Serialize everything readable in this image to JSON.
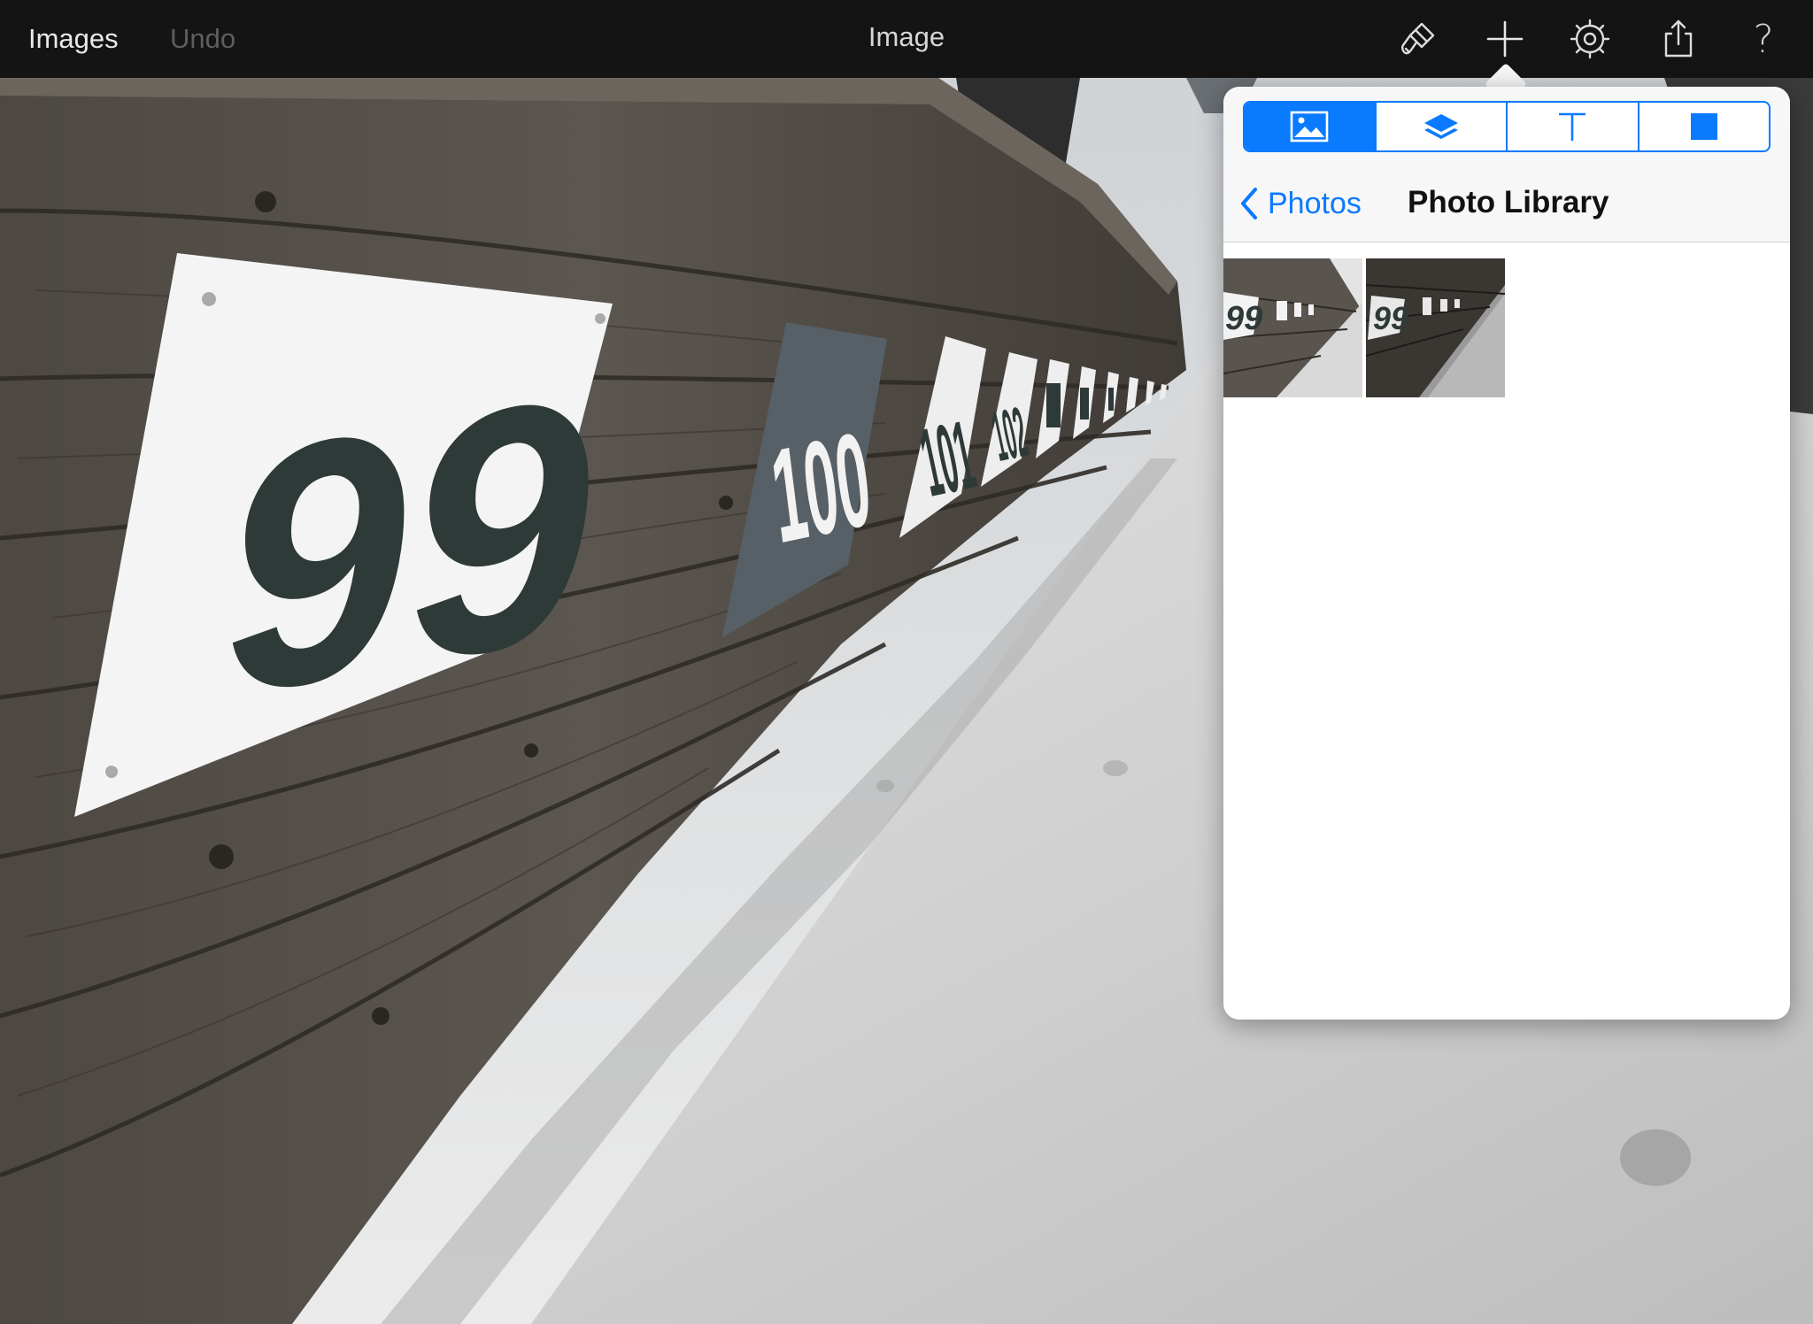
{
  "toolbar": {
    "images_label": "Images",
    "undo_label": "Undo",
    "title": "Image",
    "icons": [
      "brush-icon",
      "plus-icon",
      "gear-icon",
      "share-icon",
      "help-icon"
    ],
    "help_glyph": "?"
  },
  "photo": {
    "sign_big": "99",
    "sign_next": "100",
    "sign_third": "101",
    "sign_fourth": "102"
  },
  "popover": {
    "segments": [
      "image-icon",
      "layers-icon",
      "text-icon",
      "shape-icon"
    ],
    "active_segment": "image-icon",
    "back_label": "Photos",
    "title": "Photo Library",
    "thumbnails": [
      {
        "number": "99",
        "style": "bright"
      },
      {
        "number": "99",
        "style": "dark"
      }
    ]
  },
  "colors": {
    "accent": "#0a7aff",
    "toolbar_bg": "#141414",
    "undo_disabled": "#5e5e5e"
  }
}
